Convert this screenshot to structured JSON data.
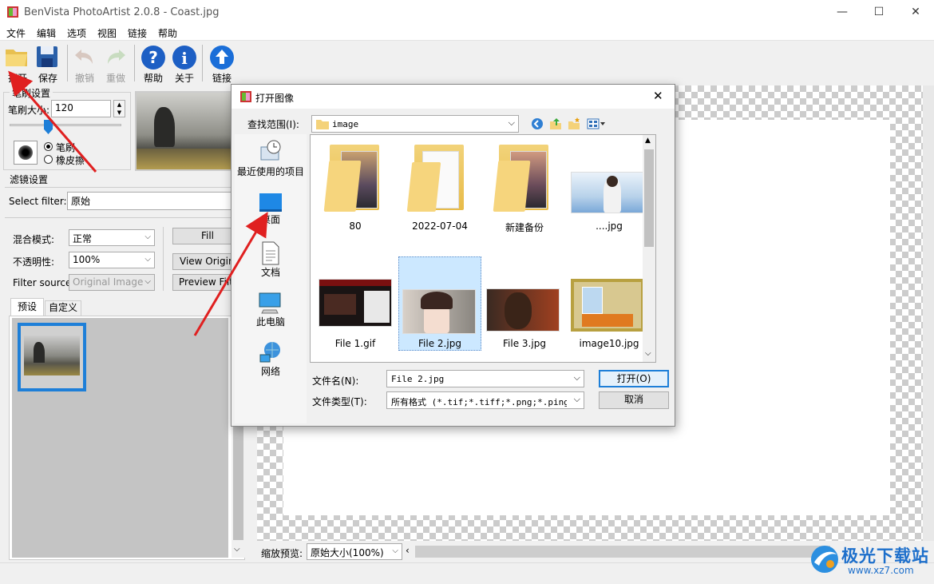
{
  "window": {
    "title": "BenVista PhotoArtist 2.0.8 - Coast.jpg",
    "minimize": "—",
    "maximize": "☐",
    "close": "✕"
  },
  "menu": [
    "文件",
    "编辑",
    "选项",
    "视图",
    "链接",
    "帮助"
  ],
  "toolbar": {
    "open": "打开",
    "save": "保存",
    "undo": "撤销",
    "redo": "重做",
    "help": "帮助",
    "about": "关于",
    "link": "链接"
  },
  "brush": {
    "group": "笔刷设置",
    "size_label": "笔刷大小:",
    "size_value": "120",
    "mode_brush": "笔刷",
    "mode_eraser": "橡皮擦",
    "selected": "brush"
  },
  "filter": {
    "group": "滤镜设置",
    "select_label": "Select filter:",
    "select_value": "原始",
    "blend_label": "混合模式:",
    "blend_value": "正常",
    "opacity_label": "不透明性:",
    "opacity_value": "100%",
    "source_label": "Filter source:",
    "source_value": "Original Image",
    "fill": "Fill",
    "view_original": "View Original",
    "preview_filter": "Preview Filter"
  },
  "tabs": {
    "preset": "预设",
    "custom": "自定义",
    "active": "preset"
  },
  "zoom": {
    "label": "缩放预览:",
    "value": "原始大小(100%)"
  },
  "dialog": {
    "title": "打开图像",
    "lookin_label": "查找范围(I):",
    "lookin_value": "image",
    "places": [
      "最近使用的项目",
      "桌面",
      "文档",
      "此电脑",
      "网络"
    ],
    "files": [
      {
        "name": "80",
        "kind": "folder"
      },
      {
        "name": "2022-07-04",
        "kind": "folder"
      },
      {
        "name": "新建备份",
        "kind": "folder"
      },
      {
        "name": "....jpg",
        "kind": "image"
      },
      {
        "name": "File 1.gif",
        "kind": "image"
      },
      {
        "name": "File 2.jpg",
        "kind": "image",
        "selected": true
      },
      {
        "name": "File 3.jpg",
        "kind": "image"
      },
      {
        "name": "image10.jpg",
        "kind": "image"
      }
    ],
    "filename_label": "文件名(N):",
    "filename_value": "File 2.jpg",
    "filetype_label": "文件类型(T):",
    "filetype_value": "所有格式 (*.tif;*.tiff;*.png;*.ping;*",
    "open_button": "打开(O)",
    "cancel_button": "取消",
    "close": "✕"
  },
  "watermark": {
    "text": "极光下载站",
    "url": "www.xz7.com"
  },
  "colors": {
    "accent": "#1e7fd8",
    "selected_bg": "#cce8ff",
    "arrow": "#e02020"
  }
}
